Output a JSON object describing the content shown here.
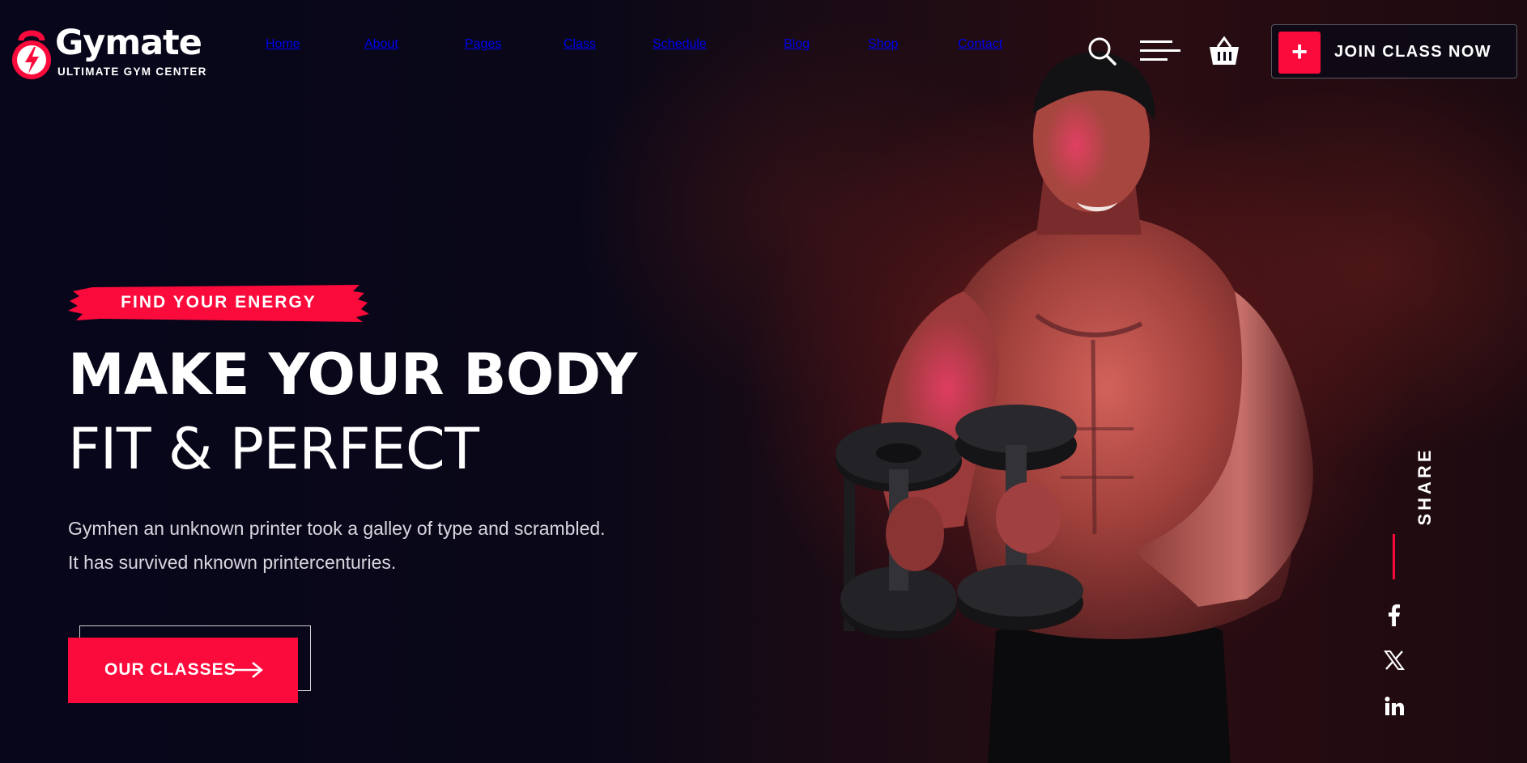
{
  "brand": {
    "name": "Gymate",
    "tagline": "ULTIMATE GYM CENTER",
    "accent_color": "#fb0a3c"
  },
  "nav": {
    "items": [
      {
        "label": "Home"
      },
      {
        "label": "About"
      },
      {
        "label": "Pages"
      },
      {
        "label": "Class"
      },
      {
        "label": "Schedule"
      },
      {
        "label": "Blog"
      },
      {
        "label": "Shop"
      },
      {
        "label": "Contact"
      }
    ]
  },
  "header_icons": [
    "search-icon",
    "menu-icon",
    "basket-icon"
  ],
  "join": {
    "icon": "plus-icon",
    "label": "JOIN CLASS NOW"
  },
  "hero": {
    "eyebrow": "FIND YOUR ENERGY",
    "headline_line1": "MAKE YOUR BODY",
    "headline_line2": "FIT & PERFECT",
    "description_line1": "Gymhen an unknown printer took a galley of type and scrambled.",
    "description_line2": "It has survived nknown printercenturies.",
    "cta_label": "OUR CLASSES",
    "cta_icon": "arrow-right-icon"
  },
  "share": {
    "label": "SHARE",
    "networks": [
      "facebook-icon",
      "x-icon",
      "linkedin-icon"
    ]
  }
}
